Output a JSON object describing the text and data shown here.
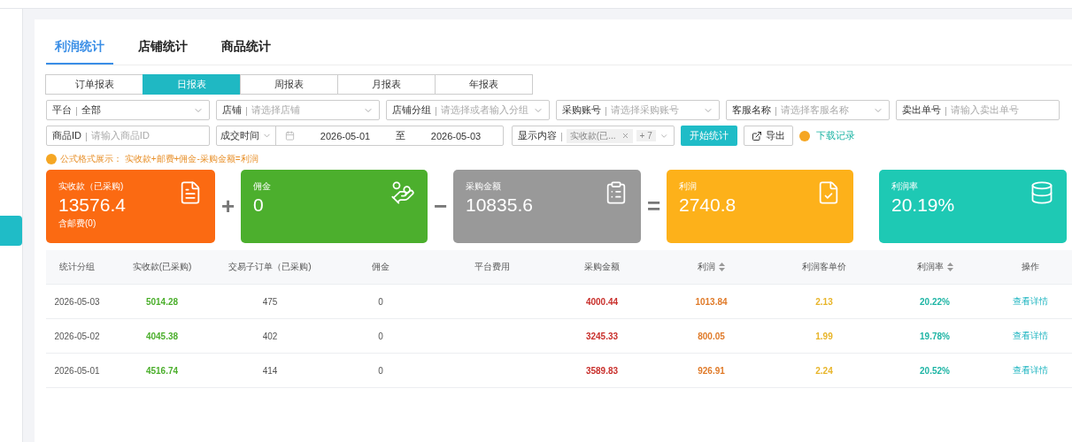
{
  "main_tabs": [
    {
      "label": "利润统计",
      "selected": true
    },
    {
      "label": "店铺统计",
      "selected": false
    },
    {
      "label": "商品统计",
      "selected": false
    }
  ],
  "report_tabs": [
    {
      "label": "订单报表",
      "selected": false
    },
    {
      "label": "日报表",
      "selected": true
    },
    {
      "label": "周报表",
      "selected": false
    },
    {
      "label": "月报表",
      "selected": false
    },
    {
      "label": "年报表",
      "selected": false
    }
  ],
  "filters": [
    {
      "kind": "select",
      "label": "平台",
      "separator": "|",
      "value": "全部"
    },
    {
      "kind": "select",
      "label": "店铺",
      "separator": "|",
      "placeholder": "请选择店铺"
    },
    {
      "kind": "select",
      "label": "店铺分组",
      "separator": "|",
      "placeholder": "请选择或者输入分组"
    },
    {
      "kind": "select",
      "label": "采购账号",
      "separator": "|",
      "placeholder": "请选择采购账号"
    },
    {
      "kind": "select",
      "label": "客服名称",
      "separator": "|",
      "placeholder": "请选择客服名称"
    },
    {
      "kind": "input",
      "label": "卖出单号",
      "separator": "|",
      "placeholder": "请输入卖出单号"
    },
    {
      "kind": "input",
      "label": "商品ID",
      "separator": "|",
      "placeholder": "请输入商品ID"
    }
  ],
  "date_filter": {
    "type": "成交时间",
    "start": "2026-05-01",
    "separator": "至",
    "end": "2026-05-03"
  },
  "display_filter": {
    "label": "显示内容",
    "separator": "|",
    "tag": "实收款(已...",
    "more": "+ 7"
  },
  "actions": {
    "start": "开始统计",
    "export": "导出",
    "download": "下载记录"
  },
  "formula": "公式格式展示：  实收款+邮费+佣金-采购金额=利润",
  "cards": [
    {
      "label": "实收款（已采购)",
      "value": "13576.4",
      "note": "含邮费(0)",
      "color": "#fb6a12",
      "operator": "+"
    },
    {
      "label": "佣金",
      "value": "0",
      "color": "#4caf2d",
      "operator": "−"
    },
    {
      "label": "采购金额",
      "value": "10835.6",
      "color": "#999999",
      "operator": "="
    },
    {
      "label": "利润",
      "value": "2740.8",
      "color": "#fdb11a"
    },
    {
      "label": "利润率",
      "value": "20.19%",
      "color": "#1ec9b4"
    }
  ],
  "table": {
    "columns": [
      {
        "title": "统计分组"
      },
      {
        "title": "实收款(已采购)",
        "color": "#4caf2d"
      },
      {
        "title": "交易子订单（已采购)"
      },
      {
        "title": "佣金"
      },
      {
        "title": "平台费用"
      },
      {
        "title": "采购金额",
        "color": "#c9302c"
      },
      {
        "title": "利润",
        "sortable": true,
        "color": "#e07b2a"
      },
      {
        "title": "利润客单价",
        "color": "#e8b52a"
      },
      {
        "title": "利润率",
        "sortable": true,
        "color": "#1fb5a5"
      },
      {
        "title": "操作"
      }
    ],
    "rows": [
      [
        "2026-05-03",
        "5014.28",
        "475",
        "0",
        "",
        "4000.44",
        "1013.84",
        "2.13",
        "20.22%",
        "查看详情"
      ],
      [
        "2026-05-02",
        "4045.38",
        "402",
        "0",
        "",
        "3245.33",
        "800.05",
        "1.99",
        "19.78%",
        "查看详情"
      ],
      [
        "2026-05-01",
        "4516.74",
        "414",
        "0",
        "",
        "3589.83",
        "926.91",
        "2.24",
        "20.52%",
        "查看详情"
      ]
    ]
  }
}
